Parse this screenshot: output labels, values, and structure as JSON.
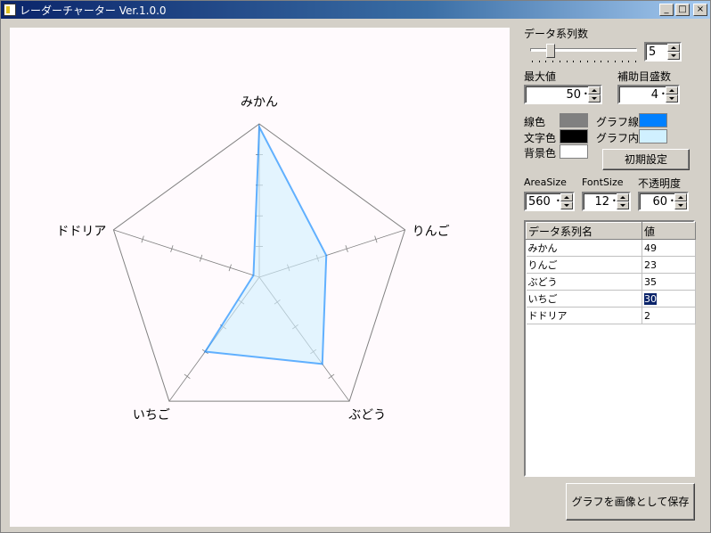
{
  "window": {
    "title": "レーダーチャーター Ver.1.0.0",
    "buttons": {
      "minimize": "_",
      "maximize": "□",
      "close": "×"
    }
  },
  "controls": {
    "series_count_label": "データ系列数",
    "series_count": "5",
    "slider_level": 0.16,
    "max_label": "最大値",
    "max_value": "50",
    "sub_ticks_label": "補助目盛数",
    "sub_ticks_value": "4",
    "line_color_label": "線色",
    "text_color_label": "文字色",
    "bg_color_label": "背景色",
    "graph_line_label": "グラフ線",
    "graph_fill_label": "グラフ内",
    "reset_button": "初期設定",
    "area_size_label": "AreaSize",
    "area_size_value": "560",
    "font_size_label": "FontSize",
    "font_size_value": "12",
    "opacity_label": "不透明度",
    "opacity_value": "60",
    "save_button": "グラフを画像として保存"
  },
  "colors": {
    "line": "#808080",
    "text": "#000000",
    "background": "#ffffff",
    "graph_line": "#0080ff",
    "graph_fill": "#d0f0ff",
    "chart_bg": "#fffafd"
  },
  "table": {
    "headers": [
      "データ系列名",
      "値"
    ],
    "rows": [
      [
        "みかん",
        "49"
      ],
      [
        "りんご",
        "23"
      ],
      [
        "ぶどう",
        "35"
      ],
      [
        "いちご",
        "30"
      ],
      [
        "ドドリア",
        "2"
      ]
    ],
    "selected_row": 3
  },
  "chart_data": {
    "type": "radar",
    "categories": [
      "みかん",
      "りんご",
      "ぶどう",
      "いちご",
      "ドドリア"
    ],
    "values": [
      49,
      23,
      35,
      30,
      2
    ],
    "rmax": 50,
    "sub_ticks": 4
  }
}
